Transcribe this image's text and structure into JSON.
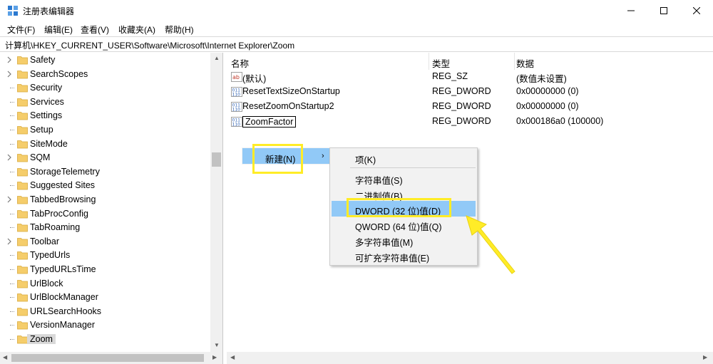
{
  "window": {
    "title": "注册表编辑器",
    "controls": {
      "minimize": "minimize-icon",
      "maximize": "maximize-icon",
      "close": "close-icon"
    }
  },
  "menu": [
    "文件(F)",
    "编辑(E)",
    "查看(V)",
    "收藏夹(A)",
    "帮助(H)"
  ],
  "address": "计算机\\HKEY_CURRENT_USER\\Software\\Microsoft\\Internet Explorer\\Zoom",
  "tree": {
    "items": [
      {
        "label": "Safety",
        "expandable": true
      },
      {
        "label": "SearchScopes",
        "expandable": true
      },
      {
        "label": "Security",
        "expandable": false
      },
      {
        "label": "Services",
        "expandable": false
      },
      {
        "label": "Settings",
        "expandable": false
      },
      {
        "label": "Setup",
        "expandable": false
      },
      {
        "label": "SiteMode",
        "expandable": false
      },
      {
        "label": "SQM",
        "expandable": true
      },
      {
        "label": "StorageTelemetry",
        "expandable": false
      },
      {
        "label": "Suggested Sites",
        "expandable": false
      },
      {
        "label": "TabbedBrowsing",
        "expandable": true
      },
      {
        "label": "TabProcConfig",
        "expandable": false
      },
      {
        "label": "TabRoaming",
        "expandable": false
      },
      {
        "label": "Toolbar",
        "expandable": true
      },
      {
        "label": "TypedUrls",
        "expandable": false
      },
      {
        "label": "TypedURLsTime",
        "expandable": false
      },
      {
        "label": "UrlBlock",
        "expandable": false
      },
      {
        "label": "UrlBlockManager",
        "expandable": false
      },
      {
        "label": "URLSearchHooks",
        "expandable": false
      },
      {
        "label": "VersionManager",
        "expandable": false
      },
      {
        "label": "Zoom",
        "expandable": false,
        "selected": true
      }
    ]
  },
  "values": {
    "headers": {
      "name": "名称",
      "type": "类型",
      "data": "数据"
    },
    "rows": [
      {
        "icon": "string-value-icon",
        "name": "(默认)",
        "type": "REG_SZ",
        "data": "(数值未设置)"
      },
      {
        "icon": "binary-value-icon",
        "name": "ResetTextSizeOnStartup",
        "type": "REG_DWORD",
        "data": "0x00000000 (0)"
      },
      {
        "icon": "binary-value-icon",
        "name": "ResetZoomOnStartup2",
        "type": "REG_DWORD",
        "data": "0x00000000 (0)"
      },
      {
        "icon": "binary-value-icon",
        "name": "ZoomFactor",
        "type": "REG_DWORD",
        "data": "0x000186a0 (100000)"
      }
    ]
  },
  "context_menu": {
    "new_item": "新建(N)",
    "submenu": [
      "项(K)",
      "字符串值(S)",
      "二进制值(B)",
      "DWORD (32 位)值(D)",
      "QWORD (64 位)值(Q)",
      "多字符串值(M)",
      "可扩充字符串值(E)"
    ],
    "highlighted": "DWORD (32 位)值(D)"
  },
  "colors": {
    "highlight": "#91c9f7",
    "annotation": "#ffec27",
    "folder": "#f5cd6b"
  }
}
